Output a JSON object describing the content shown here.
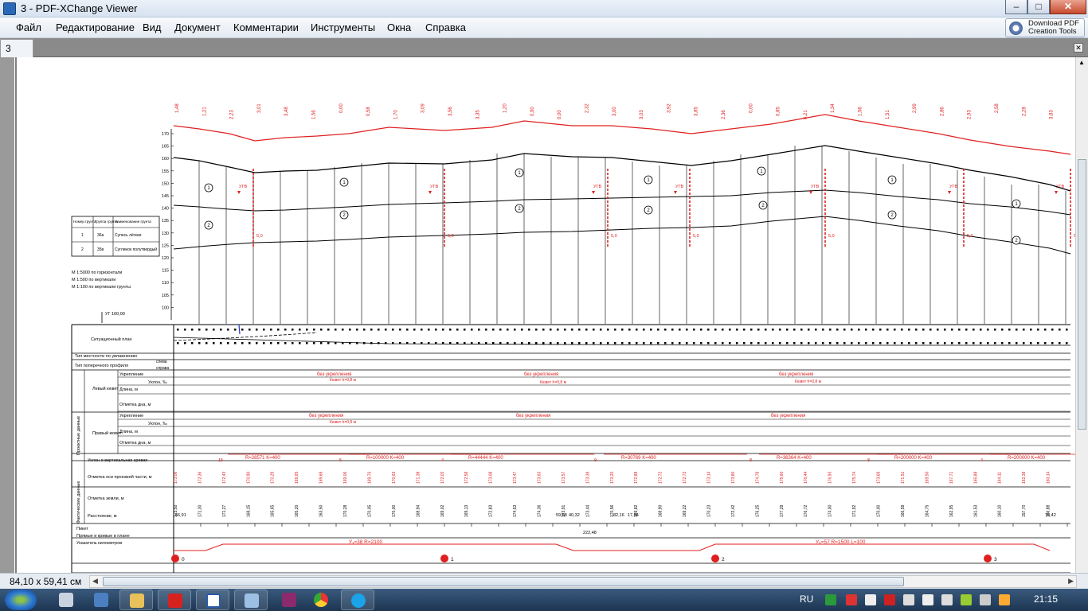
{
  "window": {
    "title": "3 - PDF-XChange Viewer"
  },
  "menu": [
    "Файл",
    "Редактирование",
    "Вид",
    "Документ",
    "Комментарии",
    "Инструменты",
    "Окна",
    "Справка"
  ],
  "download_tools": {
    "line1": "Download PDF",
    "line2": "Creation Tools"
  },
  "tab": {
    "label": "3"
  },
  "status": {
    "page_size": "84,10 x 59,41 см"
  },
  "taskbar": {
    "lang": "RU",
    "clock": "21:15"
  },
  "drawing": {
    "y_axis": [
      "170",
      "165",
      "160",
      "155",
      "150",
      "145",
      "140",
      "135",
      "130",
      "125",
      "120",
      "115",
      "110",
      "105",
      "100"
    ],
    "soil_table": {
      "headers": [
        "Номер грунта",
        "Группа грунта",
        "Наименование грунта"
      ],
      "rows": [
        [
          "1",
          "36а",
          "Супесь лёгкая"
        ],
        [
          "2",
          "35в",
          "Суглинок полутвердый"
        ]
      ]
    },
    "scale": [
      "М 1:5000   по горизонтали",
      "М 1:500   по вертикали",
      "М 1:100   по вертикали грунты"
    ],
    "datum": "УГ 100,00",
    "rows": [
      "Ситуационный план",
      "Тип местности по увлажнению",
      "Тип поперечного профиля",
      "Проектные данные",
      "Левый кювет",
      "Укрепление",
      "Уклон, ‰",
      "Длина, м",
      "Отметка дна, м",
      "Правый кювет",
      "Укрепление",
      "Уклон, ‰",
      "Длина, м",
      "Отметка дна, м",
      "Уклон и вертикальная кривая",
      "Отметка оси проезжей части, м",
      "Фактические данные",
      "Отметка земли, м",
      "Расстояние, м",
      "Пикет",
      "Прямые и кривые в плане",
      "Указатель километров"
    ],
    "side": [
      "слева",
      "справа"
    ],
    "no_reinf": "без укрепления",
    "ditch": "Кювет h=0,8 м",
    "curves": [
      "R=28571  K=400",
      "R=100000  K=400",
      "R=44444  K=400",
      "R=30769  K=400",
      "R=36364  K=400",
      "R=200000  K=400",
      "R=200000  K=400"
    ],
    "plan_curves": [
      "У₁=38   R=2100",
      "У₂=57   R=1500   L=100"
    ],
    "km": [
      "0",
      "1",
      "2",
      "3"
    ],
    "ugv": "УГВ",
    "layer_ids": [
      "1",
      "2"
    ],
    "grades": [
      "15",
      "5",
      "4",
      "9",
      "8",
      "8",
      "4"
    ],
    "distances": [
      "66,91",
      "59,68",
      "40,32",
      "82,16",
      "17,84",
      "74,42",
      "222,48"
    ],
    "top_labels": [
      "1,48",
      "1,21",
      "2,23",
      "3,01",
      "3,48",
      "1,56",
      "0,00",
      "0,58",
      "1,70",
      "3,09",
      "3,56",
      "3,35",
      "1,20",
      "0,90",
      "0,00",
      "2,32",
      "3,00",
      "3,03",
      "3,92",
      "3,85",
      "2,36",
      "0,00",
      "0,85",
      "0,21",
      "1,34",
      "1,56",
      "1,51",
      "2,99",
      "2,86",
      "2,93",
      "2,58",
      "2,28",
      "3,83"
    ],
    "ground_marks": [
      "173,50",
      "171,30",
      "171,27",
      "168,15",
      "165,65",
      "165,20",
      "163,50",
      "170,28",
      "170,05",
      "170,00",
      "168,94",
      "169,02",
      "169,13",
      "172,83",
      "174,53",
      "174,36",
      "173,91",
      "173,44",
      "170,56",
      "169,82",
      "168,90",
      "169,22",
      "170,23",
      "172,42",
      "176,25",
      "177,29",
      "176,72",
      "174,00",
      "171,92",
      "170,00",
      "166,59",
      "164,75",
      "162,95",
      "161,53",
      "160,10",
      "157,70",
      "156,88"
    ],
    "axis_marks": [
      "173,06",
      "172,36",
      "172,43",
      "170,90",
      "170,29",
      "169,65",
      "169,68",
      "169,06",
      "169,76",
      "170,63",
      "171,38",
      "172,03",
      "172,58",
      "173,08",
      "173,47",
      "173,63",
      "173,57",
      "173,39",
      "173,20",
      "172,88",
      "172,72",
      "172,73",
      "173,14",
      "173,80",
      "174,78",
      "175,60",
      "176,44",
      "176,93",
      "175,74",
      "173,69",
      "171,51",
      "169,50",
      "167,71",
      "165,88",
      "164,11",
      "162,38",
      "160,14"
    ]
  }
}
